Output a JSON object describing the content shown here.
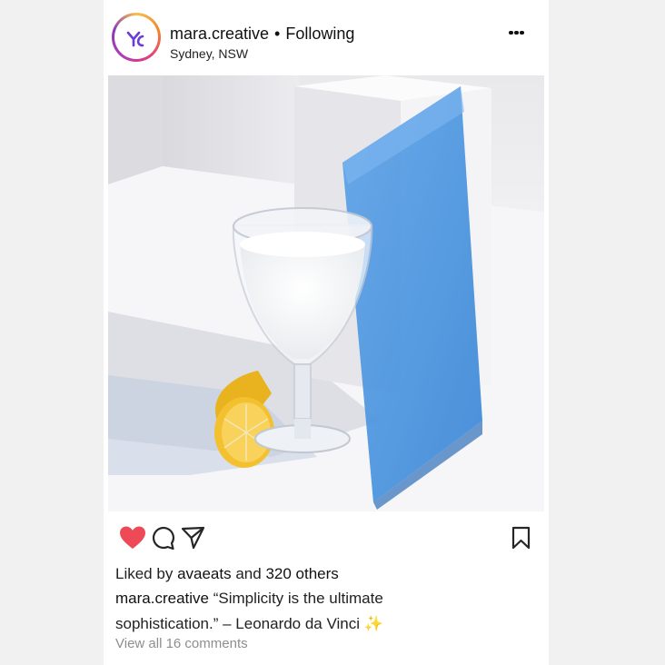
{
  "post": {
    "username": "mara.creative",
    "separator": "•",
    "follow_status": "Following",
    "location": "Sydney, NSW"
  },
  "colors": {
    "like_red": "#ed4956",
    "acrylic_blue": "#4a90d9",
    "lemon_yellow": "#f3c030"
  },
  "icons": {
    "like": "heart-filled-icon",
    "comment": "comment-bubble-icon",
    "share": "paper-plane-icon",
    "save": "bookmark-icon",
    "more": "more-options-icon"
  },
  "likes": {
    "prefix": "Liked by",
    "liker": "avaeats",
    "conjunction": "and",
    "others": "320 others"
  },
  "caption": {
    "author": "mara.creative",
    "text": "“Simplicity is the ultimate sophistication.” – Leonardo da Vinci",
    "emoji": "✨"
  },
  "comments": {
    "view_all": "View all 16 comments"
  }
}
